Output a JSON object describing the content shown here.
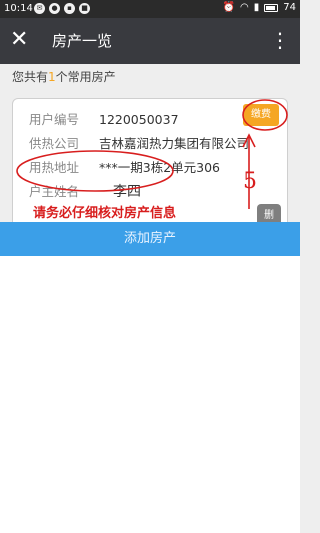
{
  "status_bar": {
    "time": "10:14",
    "battery": "74"
  },
  "nav": {
    "title": "房产一览",
    "close_glyph": "✕",
    "more_glyph": "⋮"
  },
  "summary": {
    "prefix": "您共有",
    "count": "1",
    "suffix": "个常用房产"
  },
  "property": {
    "fields": [
      {
        "label": "用户编号",
        "value": "1220050037"
      },
      {
        "label": "供热公司",
        "value": "吉林嘉润热力集团有限公司"
      },
      {
        "label": "用热地址",
        "value": "***一期3栋2单元306"
      },
      {
        "label": "户主姓名",
        "value": "李四"
      }
    ],
    "pay_label": "缴费",
    "delete_label": "删"
  },
  "annotation": {
    "note": "请务必仔细核对房产信息",
    "number": "5",
    "color": "#d81e1e"
  },
  "add_button": {
    "label": "添加房产"
  },
  "colors": {
    "nav": "#393a3f",
    "accent": "#f5a623",
    "primary": "#3b9fe8"
  }
}
